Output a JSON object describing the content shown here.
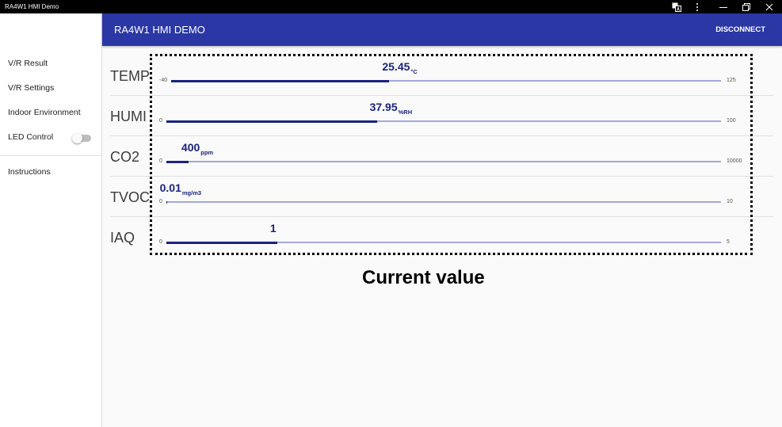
{
  "window": {
    "title": "RA4W1 HMI Demo",
    "icons": [
      "translate-icon",
      "more-options-icon",
      "minimize-icon",
      "restore-icon",
      "close-icon"
    ]
  },
  "app_bar": {
    "title": "RA4W1 HMI DEMO",
    "disconnect_label": "DISCONNECT"
  },
  "sidebar": {
    "items": [
      {
        "label": "V/R Result"
      },
      {
        "label": "V/R Settings"
      },
      {
        "label": "Indoor Environment"
      },
      {
        "label": "LED Control",
        "toggle_on": false
      }
    ],
    "bottom_items": [
      {
        "label": "Instructions"
      }
    ]
  },
  "sensors": [
    {
      "label": "TEMP",
      "value": 25.45,
      "unit": "°C",
      "min": -40,
      "max": 125
    },
    {
      "label": "HUMI",
      "value": 37.95,
      "unit": "%RH",
      "min": 0,
      "max": 100
    },
    {
      "label": "CO2",
      "value": 400,
      "unit": "ppm",
      "min": 0,
      "max": 10000
    },
    {
      "label": "TVOC",
      "value": 0.01,
      "unit": "mg/m3",
      "min": 0,
      "max": 10
    },
    {
      "label": "IAQ",
      "value": 1,
      "min": 0,
      "max": 5
    }
  ],
  "annotation": {
    "caption": "Current value"
  },
  "colors": {
    "app_bar": "#2a37a5",
    "slider_fill": "#1a237e",
    "slider_track": "#a4a8d8",
    "value_text": "#1a237e",
    "title_bar": "#000000"
  }
}
